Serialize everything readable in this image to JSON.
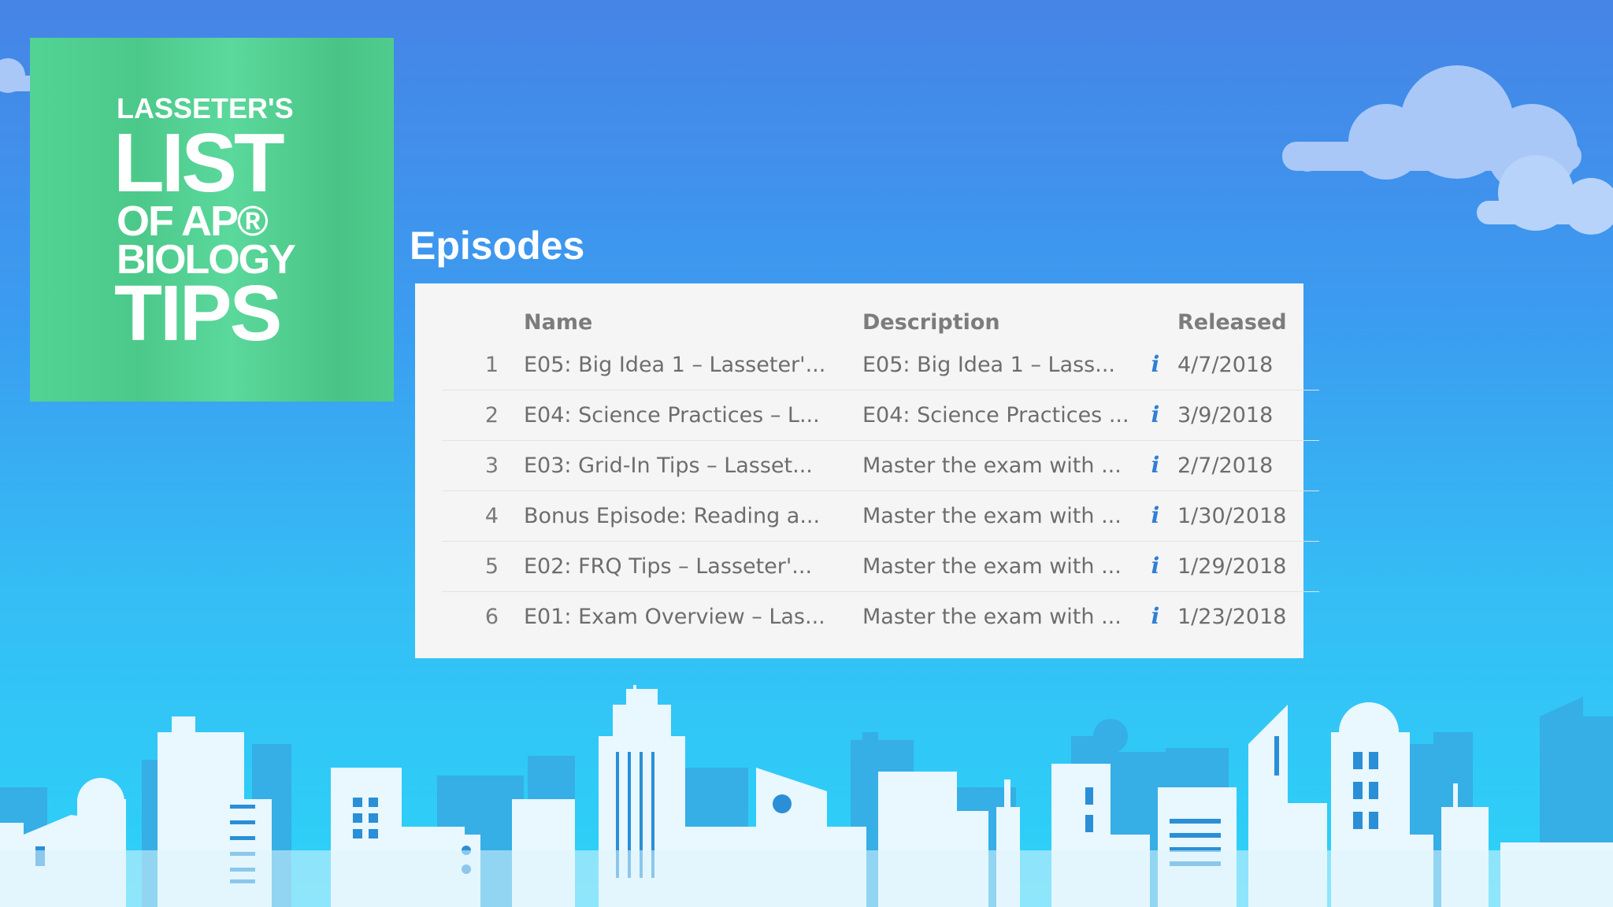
{
  "artwork": {
    "line1": "LASSETER'S",
    "line2": "LIST",
    "line3": "OF AP®",
    "line4": "BIOLOGY",
    "line5": "TIPS"
  },
  "heading": "Episodes",
  "table": {
    "columns": {
      "name": "Name",
      "description": "Description",
      "released": "Released"
    },
    "rows": [
      {
        "num": "1",
        "name": "E05: Big Idea 1 – Lasseter'...",
        "description": "E05: Big Idea 1 – Lass...",
        "released": "4/7/2018"
      },
      {
        "num": "2",
        "name": "E04: Science Practices – L...",
        "description": "E04: Science Practices ...",
        "released": "3/9/2018"
      },
      {
        "num": "3",
        "name": "E03: Grid-In Tips – Lasset...",
        "description": "Master the exam with ...",
        "released": "2/7/2018"
      },
      {
        "num": "4",
        "name": "Bonus Episode: Reading a...",
        "description": "Master the exam with ...",
        "released": "1/30/2018"
      },
      {
        "num": "5",
        "name": "E02: FRQ Tips – Lasseter'...",
        "description": "Master the exam with ...",
        "released": "1/29/2018"
      },
      {
        "num": "6",
        "name": "E01: Exam Overview – Las...",
        "description": "Master the exam with ...",
        "released": "1/23/2018"
      }
    ],
    "info_glyph": "i"
  },
  "colors": {
    "artwork_green": "#52d394",
    "panel_bg": "#f5f5f5",
    "info_blue": "#2f7fd6",
    "sky_top": "#4684e6",
    "sky_bottom": "#2cd3f8"
  }
}
